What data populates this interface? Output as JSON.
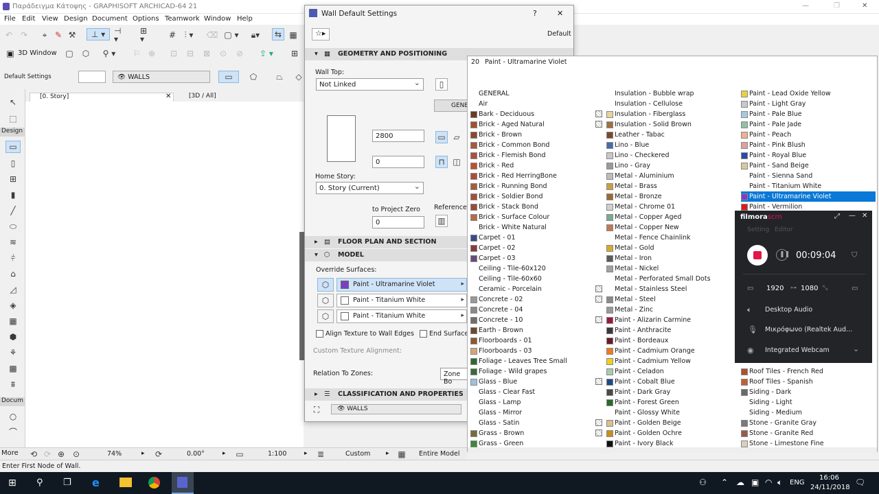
{
  "window": {
    "title": "Παράδειγμα Κάτοψης - GRAPHISOFT ARCHICAD-64 21",
    "controls": {
      "min": "—",
      "max": "❐",
      "close": "✕"
    }
  },
  "menu": [
    "File",
    "Edit",
    "View",
    "Design",
    "Document",
    "Options",
    "Teamwork",
    "Window",
    "Help"
  ],
  "toolbar": {
    "view3d_label": "3D Window",
    "default_settings_label": "Default Settings",
    "walls_label": "WALLS"
  },
  "toolbox": {
    "design_label": "Design",
    "docum_label": "Docum",
    "more_label": "More"
  },
  "tabs": {
    "story_tab": "[0. Story]",
    "tab3d": "[3D / All]"
  },
  "dialog": {
    "title": "Wall Default Settings",
    "help": "?",
    "close": "✕",
    "default_label": "Default",
    "geometry_header": "GEOMETRY AND POSITIONING",
    "wall_top_label": "Wall Top:",
    "wall_top_value": "Not Linked",
    "height_value": "2800",
    "offset_value": "0",
    "home_story_label": "Home Story:",
    "home_story_value": "0. Story (Current)",
    "to_project_zero_label": "to Project Zero",
    "project_zero_value": "0",
    "reference_label": "Reference L",
    "gene_label": "GENE",
    "floor_plan_header": "FLOOR PLAN AND SECTION",
    "model_header": "MODEL",
    "override_surfaces_label": "Override Surfaces:",
    "surfaces": [
      {
        "name": "Paint - Ultramarine Violet",
        "color": "#7b3fc4"
      },
      {
        "name": "Paint - Titanium White",
        "color": "#ffffff"
      },
      {
        "name": "Paint - Titanium White",
        "color": "#ffffff"
      }
    ],
    "align_texture_label": "Align Texture to Wall Edges",
    "end_surfaces_label": "End Surfaces:",
    "custom_texture_label": "Custom Texture Alignment:",
    "relation_zones_label": "Relation To Zones:",
    "zone_value": "Zone Bo",
    "classification_header": "CLASSIFICATION AND PROPERTIES",
    "footer_walls_label": "WALLS"
  },
  "material_popup": {
    "header_index": "20",
    "header_name": "Paint - Ultramarine Violet",
    "col1": [
      {
        "name": "GENERAL",
        "color": "",
        "tex": false
      },
      {
        "name": "Air",
        "color": "",
        "tex": false
      },
      {
        "name": "Bark - Deciduous",
        "color": "#6a3c20",
        "tex": true
      },
      {
        "name": "Brick - Aged Natural",
        "color": "#a0522d",
        "tex": true
      },
      {
        "name": "Brick - Brown",
        "color": "#8b4a2a",
        "tex": false
      },
      {
        "name": "Brick - Common Bond",
        "color": "#a65a3a",
        "tex": false
      },
      {
        "name": "Brick - Flemish Bond",
        "color": "#b0503a",
        "tex": false
      },
      {
        "name": "Brick - Red",
        "color": "#c2502f",
        "tex": false
      },
      {
        "name": "Brick - Red HerringBone",
        "color": "#b04a36",
        "tex": false
      },
      {
        "name": "Brick - Running Bond",
        "color": "#a85a40",
        "tex": false
      },
      {
        "name": "Brick - Soldier Bond",
        "color": "#a44e3c",
        "tex": false
      },
      {
        "name": "Brick - Stack Bond",
        "color": "#9c4a38",
        "tex": false
      },
      {
        "name": "Brick - Surface Colour",
        "color": "#b86a4a",
        "tex": false
      },
      {
        "name": "Brick - White Natural",
        "color": "",
        "tex": false
      },
      {
        "name": "Carpet - 01",
        "color": "#3a4a8a",
        "tex": false
      },
      {
        "name": "Carpet - 02",
        "color": "#8a3a3a",
        "tex": false
      },
      {
        "name": "Carpet - 03",
        "color": "#6a4a7a",
        "tex": false
      },
      {
        "name": "Ceiling - Tile-60x120",
        "color": "",
        "tex": false
      },
      {
        "name": "Ceiling - Tile-60x60",
        "color": "",
        "tex": false
      },
      {
        "name": "Ceramic - Porcelain",
        "color": "",
        "tex": true
      },
      {
        "name": "Concrete - 02",
        "color": "#999999",
        "tex": true
      },
      {
        "name": "Concrete - 04",
        "color": "#8a8a8a",
        "tex": false
      },
      {
        "name": "Concrete - 10",
        "color": "#6e6e6e",
        "tex": true
      },
      {
        "name": "Earth - Brown",
        "color": "#6a4a2a",
        "tex": false
      },
      {
        "name": "Floorboards - 01",
        "color": "#8a5a30",
        "tex": false
      },
      {
        "name": "Floorboards - 03",
        "color": "#d2a678",
        "tex": false
      },
      {
        "name": "Foliage - Leaves Tree Small",
        "color": "#2e6a2e",
        "tex": false
      },
      {
        "name": "Foliage - Wild grapes",
        "color": "#3a6a3a",
        "tex": false
      },
      {
        "name": "Glass - Blue",
        "color": "#9fc0e0",
        "tex": true
      },
      {
        "name": "Glass - Clear Fast",
        "color": "",
        "tex": false
      },
      {
        "name": "Glass - Lamp",
        "color": "",
        "tex": false
      },
      {
        "name": "Glass - Mirror",
        "color": "",
        "tex": false
      },
      {
        "name": "Glass - Satin",
        "color": "",
        "tex": true
      },
      {
        "name": "Grass - Brown",
        "color": "#7a6a3a",
        "tex": true
      },
      {
        "name": "Grass - Green",
        "color": "#3a8a3a",
        "tex": false
      }
    ],
    "col2": [
      {
        "name": "Insulation - Bubble wrap",
        "color": "",
        "tex": false
      },
      {
        "name": "Insulation - Cellulose",
        "color": "",
        "tex": false
      },
      {
        "name": "Insulation - Fiberglass",
        "color": "#e8d3a0",
        "tex": false
      },
      {
        "name": "Insulation - Solid Brown",
        "color": "#a07040",
        "tex": false
      },
      {
        "name": "Leather - Tabac",
        "color": "#7a4a2a",
        "tex": false
      },
      {
        "name": "Lino - Blue",
        "color": "#4a6aaa",
        "tex": false
      },
      {
        "name": "Lino - Checkered",
        "color": "#c8c8c8",
        "tex": false
      },
      {
        "name": "Lino - Gray",
        "color": "#9a9a9a",
        "tex": false
      },
      {
        "name": "Metal - Aluminium",
        "color": "#bcbcbc",
        "tex": false
      },
      {
        "name": "Metal - Brass",
        "color": "#c9a040",
        "tex": false
      },
      {
        "name": "Metal - Bronze",
        "color": "#9a6a30",
        "tex": false
      },
      {
        "name": "Metal - Chrome 01",
        "color": "#d0d0d0",
        "tex": false
      },
      {
        "name": "Metal - Copper Aged",
        "color": "#7aaa90",
        "tex": false
      },
      {
        "name": "Metal - Copper New",
        "color": "#c07a50",
        "tex": false
      },
      {
        "name": "Metal - Fence Chainlink",
        "color": "",
        "tex": false
      },
      {
        "name": "Metal - Gold",
        "color": "#d4aa30",
        "tex": false
      },
      {
        "name": "Metal - Iron",
        "color": "#5a5a5a",
        "tex": false
      },
      {
        "name": "Metal - Nickel",
        "color": "#a0a0a0",
        "tex": false
      },
      {
        "name": "Metal - Perforated Small Dots",
        "color": "",
        "tex": false
      },
      {
        "name": "Metal - Stainless Steel",
        "color": "",
        "tex": false
      },
      {
        "name": "Metal - Steel",
        "color": "#8a8a8a",
        "tex": false
      },
      {
        "name": "Metal - Zinc",
        "color": "#9a9a9a",
        "tex": false
      },
      {
        "name": "Paint - Alizarin Carmine",
        "color": "#9a1a3a",
        "tex": false
      },
      {
        "name": "Paint - Anthracite",
        "color": "#3a3a3a",
        "tex": false
      },
      {
        "name": "Paint - Bordeaux",
        "color": "#6a1a2a",
        "tex": false
      },
      {
        "name": "Paint - Cadmium Orange",
        "color": "#f07a1a",
        "tex": false
      },
      {
        "name": "Paint - Cadmium Yellow",
        "color": "#f0d01a",
        "tex": false
      },
      {
        "name": "Paint - Celadon",
        "color": "#aaccaa",
        "tex": false
      },
      {
        "name": "Paint - Cobalt Blue",
        "color": "#1a4a8a",
        "tex": false
      },
      {
        "name": "Paint - Dark Gray",
        "color": "#4a4a4a",
        "tex": false
      },
      {
        "name": "Paint - Forest Green",
        "color": "#2a6a2a",
        "tex": false
      },
      {
        "name": "Paint - Glossy White",
        "color": "",
        "tex": false
      },
      {
        "name": "Paint - Golden Beige",
        "color": "#d8c08a",
        "tex": false
      },
      {
        "name": "Paint - Golden Ochre",
        "color": "#c8901a",
        "tex": false
      },
      {
        "name": "Paint - Ivory Black",
        "color": "#111111",
        "tex": false
      }
    ],
    "col3": [
      {
        "name": "Paint - Lead Oxide Yellow",
        "color": "#e8d040",
        "tex": false
      },
      {
        "name": "Paint - Light Gray",
        "color": "#c8c8c8",
        "tex": false
      },
      {
        "name": "Paint - Pale Blue",
        "color": "#a8c8e0",
        "tex": false
      },
      {
        "name": "Paint - Pale Jade",
        "color": "#90c0a8",
        "tex": false
      },
      {
        "name": "Paint - Peach",
        "color": "#f0b090",
        "tex": false
      },
      {
        "name": "Paint - Pink Blush",
        "color": "#e0a0a0",
        "tex": false
      },
      {
        "name": "Paint - Royal Blue",
        "color": "#2a4aaa",
        "tex": false
      },
      {
        "name": "Paint - Sand Beige",
        "color": "#d8c8a0",
        "tex": false
      },
      {
        "name": "Paint - Sienna Sand",
        "color": "",
        "tex": false
      },
      {
        "name": "Paint - Titanium White",
        "color": "",
        "tex": false
      },
      {
        "name": "Paint - Ultramarine Violet",
        "color": "#7b3fc4",
        "tex": false,
        "selected": true
      },
      {
        "name": "Paint - Vermilion",
        "color": "#e01a1a",
        "tex": false
      }
    ],
    "col3_bottom": [
      {
        "name": "Roof Tiles - French Red",
        "color": "#b0502a",
        "tex": false
      },
      {
        "name": "Roof Tiles - Spanish",
        "color": "#c06030",
        "tex": false
      },
      {
        "name": "Siding - Dark",
        "color": "#6a6a6a",
        "tex": false
      },
      {
        "name": "Siding - Light",
        "color": "",
        "tex": false
      },
      {
        "name": "Siding - Medium",
        "color": "",
        "tex": false
      },
      {
        "name": "Stone - Granite Gray",
        "color": "#7a7a7a",
        "tex": false
      },
      {
        "name": "Stone - Granite Red",
        "color": "#9a5a4a",
        "tex": false
      },
      {
        "name": "Stone - Limestone Fine",
        "color": "#d8d0b8",
        "tex": false
      }
    ]
  },
  "filmora": {
    "brand": "filmora",
    "brand2": "scrn",
    "tab_settings": "Setting",
    "tab_editor": "Editor",
    "timer": "00:09:04",
    "width": "1920",
    "height": "1080",
    "desktop_audio": "Desktop Audio",
    "microphone": "Μικρόφωνο (Realtek Aud...",
    "webcam": "Integrated Webcam"
  },
  "navbar": {
    "zoom": "74%",
    "angle": "0.00°",
    "scale": "1:100",
    "layer": "Custom",
    "model": "Entire Model"
  },
  "status": {
    "text": "Enter First Node of Wall."
  },
  "taskbar": {
    "lang": "ENG",
    "time": "16:06",
    "date": "24/11/2018"
  },
  "colors": {
    "selection": "#0a78d7",
    "filmora_record": "#e0174a"
  }
}
